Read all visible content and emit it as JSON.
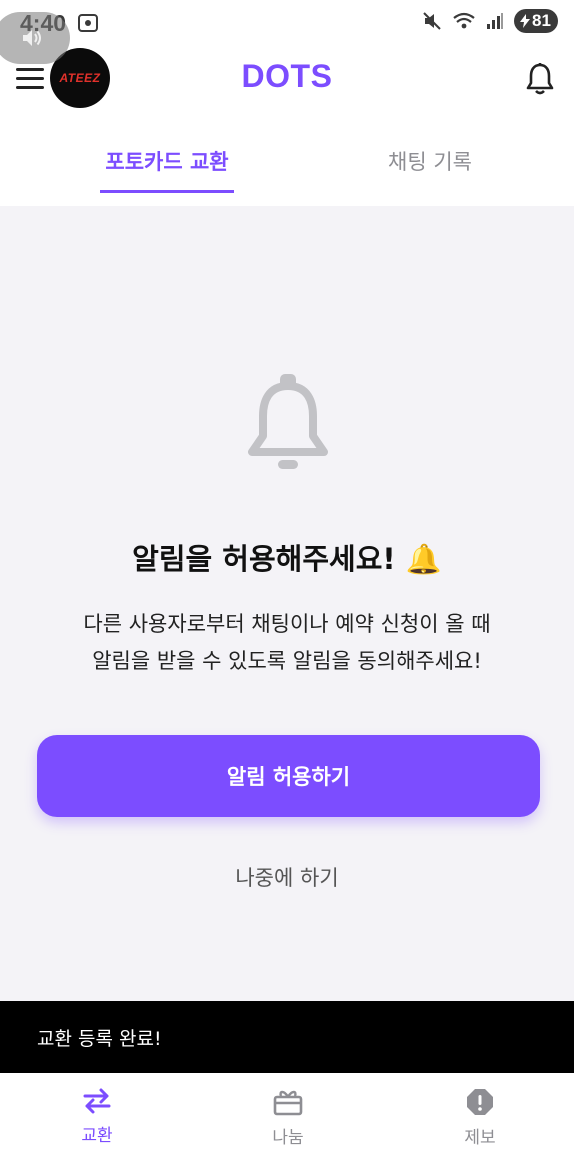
{
  "status_bar": {
    "time": "4:40",
    "battery": "81"
  },
  "header": {
    "title": "DOTS",
    "avatar_text": "ATEEZ"
  },
  "tabs": [
    {
      "label": "포토카드 교환",
      "active": true
    },
    {
      "label": "채팅 기록",
      "active": false
    }
  ],
  "notice": {
    "heading": "알림을 허용해주세요! 🔔",
    "description_line1": "다른 사용자로부터 채팅이나 예약 신청이 올 때",
    "description_line2": "알림을 받을 수 있도록 알림을 동의해주세요!",
    "allow_button": "알림 허용하기",
    "later_button": "나중에 하기"
  },
  "toast": {
    "message": "교환 등록 완료!"
  },
  "bottom_nav": [
    {
      "label": "교환",
      "icon": "swap-arrows-icon",
      "active": true
    },
    {
      "label": "나눔",
      "icon": "gift-icon",
      "active": false
    },
    {
      "label": "제보",
      "icon": "report-icon",
      "active": false
    }
  ],
  "colors": {
    "accent": "#7c4dff",
    "toast_bg": "#000000",
    "page_bg": "#f4f3f7"
  }
}
